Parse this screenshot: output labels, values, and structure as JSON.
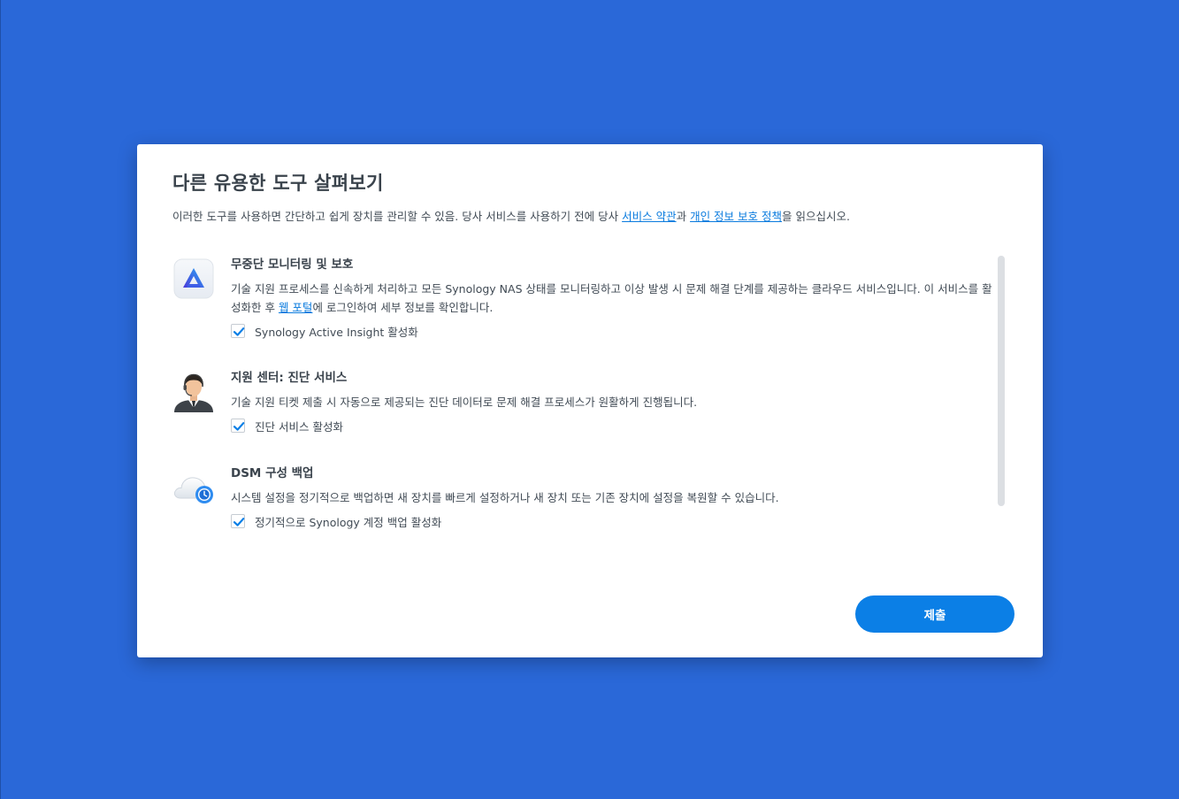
{
  "dialog": {
    "title": "다른 유용한 도구 살펴보기",
    "description": {
      "prefix": "이러한 도구를 사용하면 간단하고 쉽게 장치를 관리할 수 있음. 당사 서비스를 사용하기 전에 당사 ",
      "terms_link": "서비스 약관",
      "middle": "과 ",
      "privacy_link": "개인 정보 보호 정책",
      "suffix": "을 읽으십시오."
    },
    "items": [
      {
        "icon": "active-insight-icon",
        "title": "무중단 모니터링 및 보호",
        "desc_prefix": "기술 지원 프로세스를 신속하게 처리하고 모든 Synology NAS 상태를 모니터링하고 이상 발생 시 문제 해결 단계를 제공하는 클라우드 서비스입니다. 이 서비스를 활성화한 후 ",
        "desc_link": "웹 포털",
        "desc_suffix": "에 로그인하여 세부 정보를 확인합니다.",
        "checkbox_label": "Synology Active Insight 활성화",
        "checked": true
      },
      {
        "icon": "support-agent-icon",
        "title": "지원 센터: 진단 서비스",
        "desc": "기술 지원 티켓 제출 시 자동으로 제공되는 진단 데이터로 문제 해결 프로세스가 원활하게 진행됩니다.",
        "checkbox_label": "진단 서비스 활성화",
        "checked": true
      },
      {
        "icon": "cloud-backup-icon",
        "title": "DSM 구성 백업",
        "desc": "시스템 설정을 정기적으로 백업하면 새 장치를 빠르게 설정하거나 새 장치 또는 기존 장치에 설정을 복원할 수 있습니다.",
        "checkbox_label": "정기적으로 Synology 계정 백업 활성화",
        "checked": true
      }
    ],
    "submit_label": "제출"
  },
  "colors": {
    "background": "#2a68d8",
    "accent": "#0b7fe6",
    "link": "#0a7bde"
  }
}
